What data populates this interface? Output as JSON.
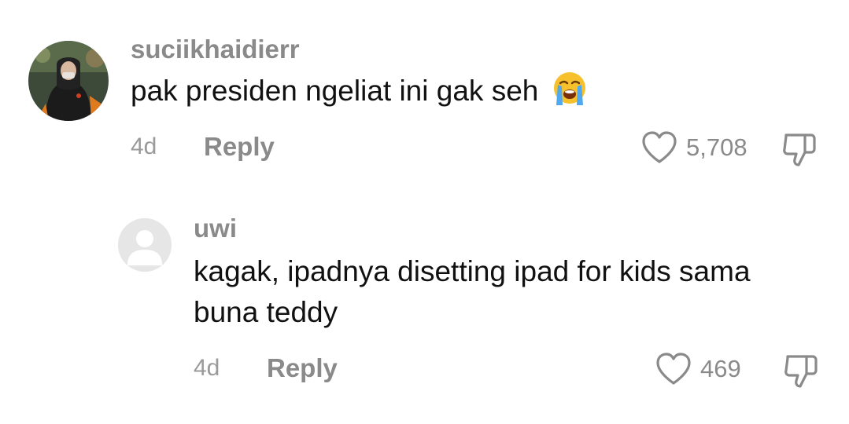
{
  "comments": [
    {
      "username": "suciikhaidierr",
      "text": "pak presiden ngeliat ini gak seh",
      "emoji": "loudly-crying-face-icon",
      "time": "4d",
      "reply_label": "Reply",
      "likes": "5,708"
    },
    {
      "username": "uwi",
      "text_line1": "kagak, ipadnya disetting ipad for kids sama",
      "text_line2": "buna teddy",
      "time": "4d",
      "reply_label": "Reply",
      "likes": "469"
    }
  ],
  "colors": {
    "meta_gray": "#8a8a8a",
    "text_dark": "#111111",
    "default_avatar_bg": "#e6e6e6"
  }
}
